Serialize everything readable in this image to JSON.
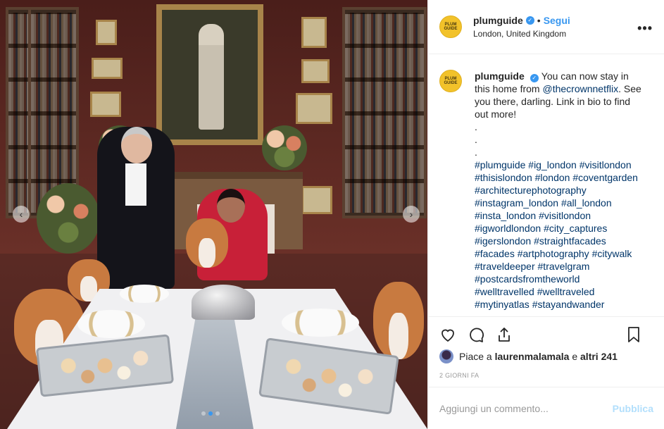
{
  "post": {
    "username": "plumguide",
    "avatar_text": "PLUM GUIDE",
    "follow_label": "Segui",
    "bullet": "•",
    "location": "London, United Kingdom",
    "more_label": "•••"
  },
  "caption": {
    "username": "plumguide",
    "text_before": "You can now stay in this home from",
    "mention": "@thecrownnetflix",
    "text_after": ". See you there, darling. Link in bio to find out more!",
    "dots": [
      ".",
      ".",
      "."
    ],
    "hashtags_lines": [
      "#plumguide #ig_london #visitlondon",
      "#thisislondon #london #coventgarden",
      "#architecturephotography",
      "#instagram_london #all_london",
      "#insta_london #visitlondon",
      "#igworldlondon #city_captures",
      "#igerslondon #straightfacades",
      "#facades #artphotography #citywalk",
      "#traveldeeper #travelgram",
      "#postcardsfromtheworld",
      "#welltravelled #welltraveled",
      "#mytinyatlas #stayandwander"
    ]
  },
  "likes": {
    "prefix": "Piace a",
    "user": "laurenmalamala",
    "middle": "e",
    "others": "altri 241"
  },
  "time": "2 GIORNI FA",
  "comment": {
    "placeholder": "Aggiungi un commento...",
    "publish_label": "Pubblica"
  },
  "carousel": {
    "total": 3,
    "active": 1,
    "prev_icon": "‹",
    "next_icon": "›"
  },
  "colors": {
    "accent": "#3897f0",
    "link": "#003569",
    "avatar_bg": "#f2c22a",
    "publish_disabled": "#b2dffc"
  },
  "icons": [
    "heart-icon",
    "comment-icon",
    "share-icon",
    "bookmark-icon",
    "verified-icon",
    "more-options-icon"
  ]
}
